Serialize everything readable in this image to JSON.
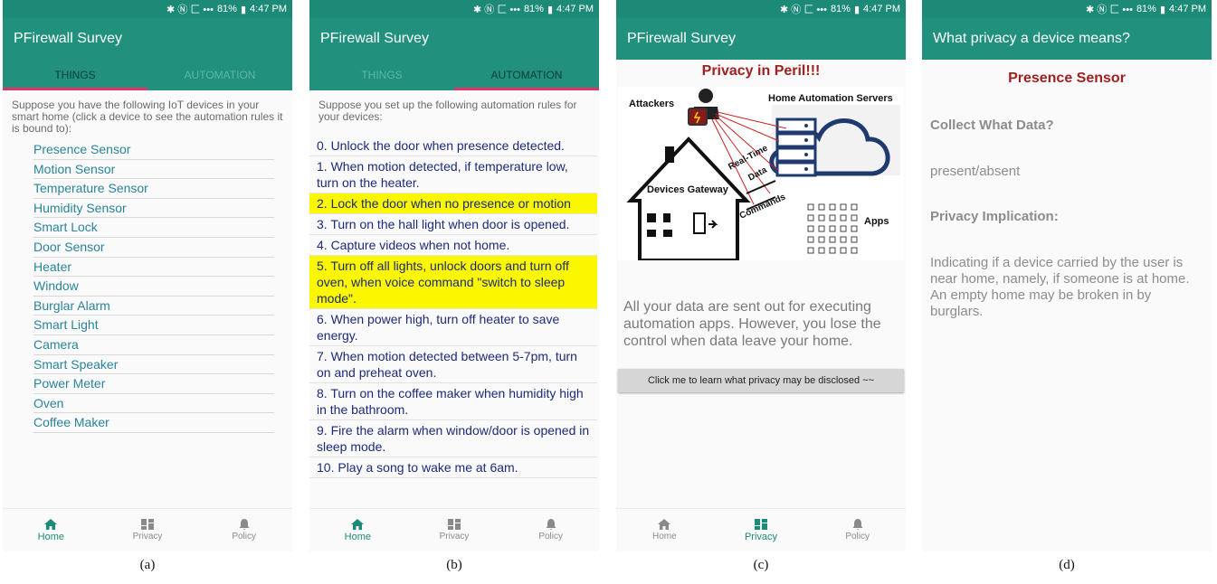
{
  "status_bar": {
    "icons": "✱ Ⓝ ⼕ •••",
    "battery": "81%",
    "time": "4:47 PM"
  },
  "app_title": "PFirewall Survey",
  "tabs": {
    "things": "THINGS",
    "automation": "AUTOMATION"
  },
  "nav": {
    "home": "Home",
    "privacy": "Privacy",
    "policy": "Policy"
  },
  "screen_a": {
    "intro": "Suppose you have the following IoT devices in your smart home (click a device to see the automation rules it is bound to):",
    "devices": [
      "Presence Sensor",
      "Motion Sensor",
      "Temperature Sensor",
      "Humidity Sensor",
      "Smart Lock",
      "Door Sensor",
      "Heater",
      "Window",
      "Burglar Alarm",
      "Smart Light",
      "Camera",
      "Smart Speaker",
      "Power Meter",
      "Oven",
      "Coffee Maker"
    ]
  },
  "screen_b": {
    "intro": "Suppose you set up the following automation rules for your devices:",
    "rules": [
      "0. Unlock the door when presence detected.",
      "1. When motion detected, if temperature low, turn on the heater.",
      "2. Lock the door when no presence or motion",
      "3. Turn on the hall light when door is opened.",
      "4. Capture videos when not home.",
      "5. Turn off all lights, unlock doors and turn off oven, when voice command \"switch to sleep mode\".",
      "6. When power high, turn off heater to save energy.",
      "7. When motion detected between 5-7pm, turn on and preheat oven.",
      "8. Turn on the coffee maker when humidity high in the bathroom.",
      "9. Fire the alarm when window/door is opened in sleep mode.",
      "10. Play a song to wake me at 6am."
    ],
    "highlighted": [
      2,
      5
    ]
  },
  "screen_c": {
    "title": "Privacy in Peril!!!",
    "diagram": {
      "attackers": "Attackers",
      "servers": "Home Automation Servers",
      "realtime": "Real-Time",
      "data": "Data",
      "commands": "Commands",
      "gateway": "Devices Gateway",
      "apps": "Apps"
    },
    "body": "All your data are sent out for executing automation apps. However, you lose the control when data leave your home.",
    "button": "Click me to learn what privacy may be disclosed ~~"
  },
  "screen_d": {
    "appbar": "What privacy a device means?",
    "device": "Presence Sensor",
    "collect_head": "Collect What Data?",
    "collect_value": "present/absent",
    "implication_head": "Privacy Implication:",
    "implication_body": "Indicating if a device carried by the user is near home, namely, if someone is at home. An empty home may be broken in by burglars."
  },
  "captions": [
    "(a)",
    "(b)",
    "(c)",
    "(d)"
  ],
  "colors": {
    "primary": "#21907c",
    "accent": "#e0336b",
    "highlight": "#fbf700",
    "title_red": "#a12020"
  }
}
